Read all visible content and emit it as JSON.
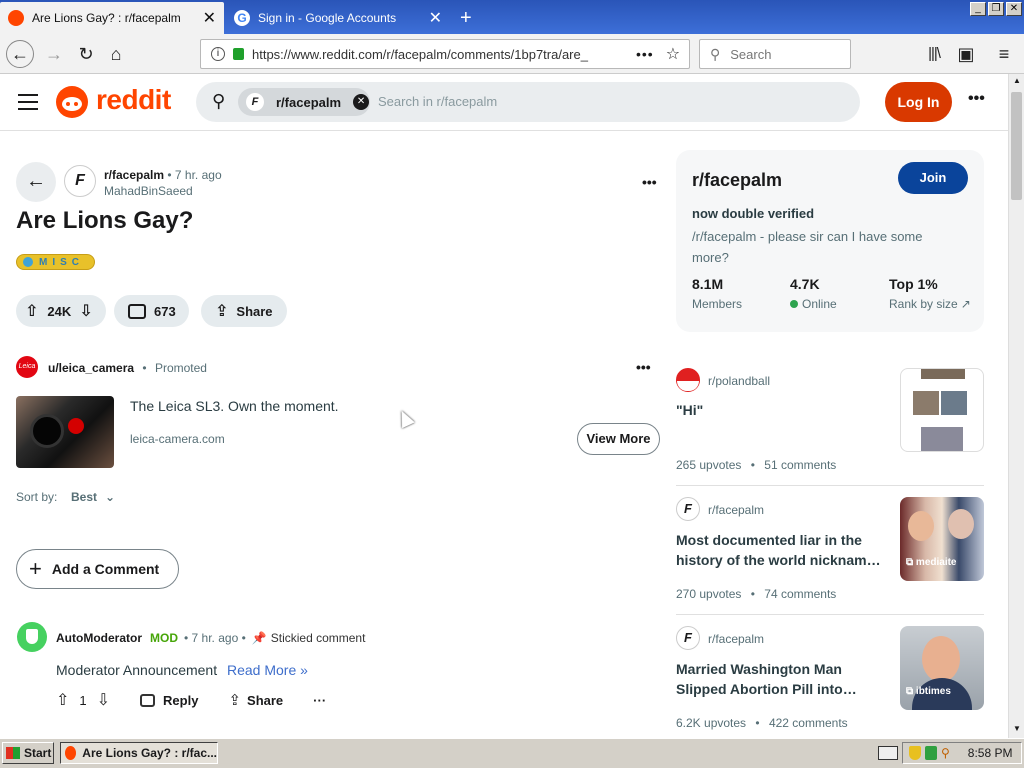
{
  "browser": {
    "tabs": [
      {
        "title": "Are Lions Gay? : r/facepalm",
        "active": true
      },
      {
        "title": "Sign in - Google Accounts",
        "active": false
      }
    ],
    "url": "https://www.reddit.com/r/facepalm/comments/1bp7tra/are_",
    "search_placeholder": "Search"
  },
  "header": {
    "logo": "reddit",
    "subreddit_chip": "r/facepalm",
    "search_placeholder": "Search in r/facepalm",
    "login": "Log In"
  },
  "post": {
    "subreddit": "r/facepalm",
    "age": "• 7 hr. ago",
    "author": "MahadBinSaeed",
    "title": "Are Lions Gay?",
    "flair": "MISC",
    "votes": "24K",
    "comments": "673",
    "share": "Share"
  },
  "promo": {
    "user": "u/leica_camera",
    "tag": "Promoted",
    "text": "The Leica SL3. Own the moment.",
    "domain": "leica-camera.com",
    "cta": "View More"
  },
  "sort": {
    "label": "Sort by:",
    "value": "Best"
  },
  "add_comment": "Add a Comment",
  "comment": {
    "author": "AutoModerator",
    "mod": "MOD",
    "age": "• 7 hr. ago •",
    "stickied": "Stickied comment",
    "text": "Moderator Announcement",
    "readmore": "Read More »",
    "votes": "1",
    "reply": "Reply",
    "share": "Share"
  },
  "sidebar": {
    "name": "r/facepalm",
    "join": "Join",
    "tagline": "now double verified",
    "desc": "/r/facepalm - please sir can I have some more?",
    "members_value": "8.1M",
    "members_label": "Members",
    "online_value": "4.7K",
    "online_label": "Online",
    "rank_value": "Top 1%",
    "rank_label": "Rank by size"
  },
  "recommendations": [
    {
      "sub": "r/polandball",
      "title": "\"Hi\"",
      "upvotes": "265 upvotes",
      "comments": "51 comments",
      "thumb_label": ""
    },
    {
      "sub": "r/facepalm",
      "title": "Most documented liar in the history of the world nicknam…",
      "upvotes": "270 upvotes",
      "comments": "74 comments",
      "thumb_label": "mediaite"
    },
    {
      "sub": "r/facepalm",
      "title": "Married Washington Man Slipped Abortion Pill into…",
      "upvotes": "6.2K upvotes",
      "comments": "422 comments",
      "thumb_label": "ibtimes"
    }
  ],
  "taskbar": {
    "start": "Start",
    "window": "Are Lions Gay? : r/fac...",
    "clock": "8:58 PM"
  },
  "colors": {
    "brand": "#ff4500",
    "login": "#d93900",
    "join": "#0a449b",
    "mod": "#46a508",
    "online": "#2ea44f"
  }
}
